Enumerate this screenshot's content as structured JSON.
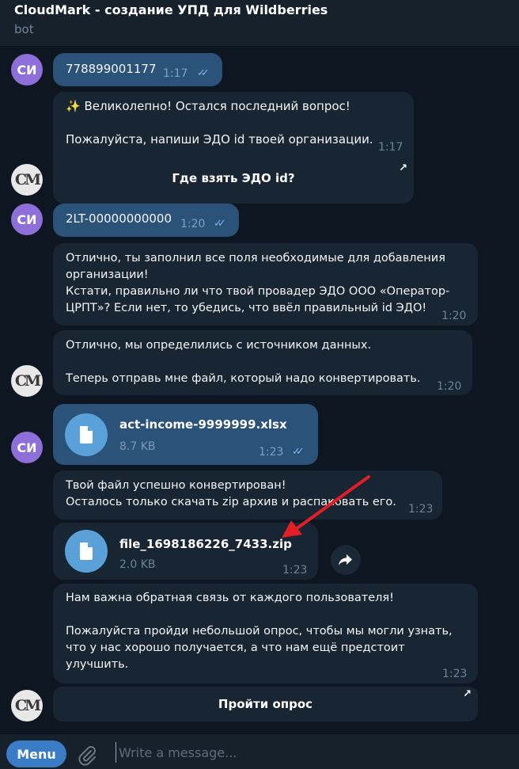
{
  "header": {
    "title": "CloudMark - создание УПД для Wildberries",
    "subtitle": "bot"
  },
  "avatars": {
    "user": "СИ",
    "bot": "СМ"
  },
  "messages": {
    "m1": {
      "text": "778899001177",
      "time": "1:17"
    },
    "m2": {
      "text": "✨ Великолепно! Остался последний вопрос!\n\nПожалуйста, напиши ЭДО id твоей организации.",
      "time": "1:17"
    },
    "btn1": {
      "label": "Где взять ЭДО id?"
    },
    "m3": {
      "text": "2LT-00000000000",
      "time": "1:20"
    },
    "m4": {
      "text": "Отлично, ты заполнил все поля необходимые для добавления\nорганизации!\nКстати, правильно ли что твой провадер ЭДО ООО «Оператор-\nЦРПТ»? Если нет, то убедись, что ввёл правильный id ЭДО!",
      "time": "1:20"
    },
    "m5": {
      "text": "Отлично, мы определились с источником данных.\n\nТеперь отправь мне файл, который надо конвертировать.",
      "time": "1:20"
    },
    "m6": {
      "file_name": "act-income-9999999.xlsx",
      "file_size": "8.7 KB",
      "time": "1:23"
    },
    "m7": {
      "text": "Твой файл успешно конвертирован!\nОсталось только скачать zip архив и распаковать его.",
      "time": "1:23"
    },
    "m8": {
      "file_name": "file_1698186226_7433.zip",
      "file_size": "2.0 KB",
      "time": "1:23"
    },
    "m9": {
      "text": "Нам важна обратная связь от каждого пользователя!\n\nПожалуйста пройди небольшой опрос, чтобы мы могли узнать,\nчто у нас хорошо получается, а что нам ещё предстоит\nулучшить.",
      "time": "1:23"
    },
    "btn2": {
      "label": "Пройти опрос"
    }
  },
  "composer": {
    "menu_label": "Menu",
    "placeholder": "Write a message..."
  },
  "colors": {
    "outgoing": "#2b5278",
    "incoming": "#182533",
    "background": "#0e1621",
    "accent": "#3a7cc6",
    "annotation_arrow": "#e31e24"
  },
  "icons": {
    "attach": "paperclip-icon",
    "file": "document-icon",
    "share": "share-arrow-icon",
    "read": "double-check-icon",
    "external": "arrow-up-right-icon"
  }
}
